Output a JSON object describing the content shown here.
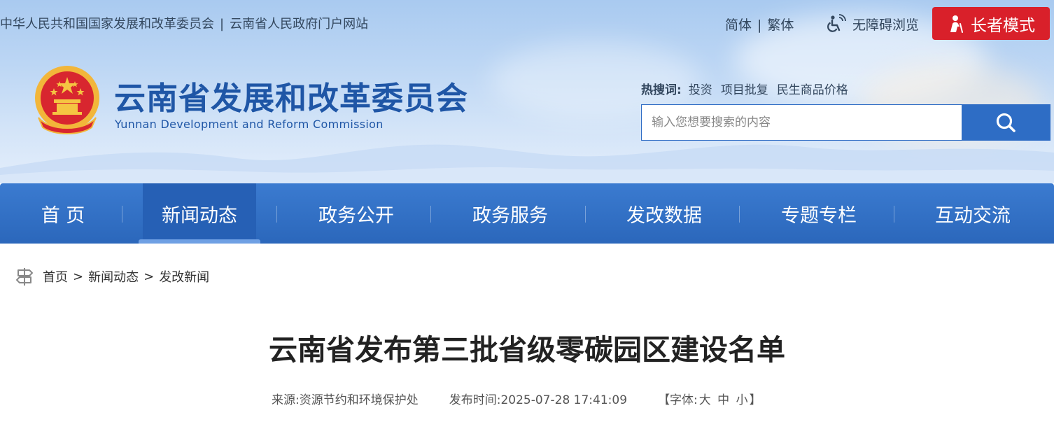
{
  "topbar": {
    "link1": "中华人民共和国国家发展和改革委员会",
    "separator": "|",
    "link2": "云南省人民政府门户网站"
  },
  "lang": {
    "simplified": "简体",
    "separator": "|",
    "traditional": "繁体"
  },
  "accessibility": {
    "label": "无障碍浏览",
    "icon": "wheelchair-signal-icon"
  },
  "elder_mode": {
    "label": "长者模式",
    "icon": "elder-person-icon",
    "color": "#d9202a"
  },
  "site": {
    "title": "云南省发展和改革委员会",
    "title_en": "Yunnan Development and Reform Commission",
    "emblem": "national-emblem"
  },
  "hot_search": {
    "label": "热搜词:",
    "items": [
      "投资",
      "项目批复",
      "民生商品价格"
    ]
  },
  "search": {
    "placeholder": "输入您想要搜索的内容",
    "icon": "search-icon",
    "button_color": "#2e6dc5"
  },
  "nav": {
    "items": [
      {
        "label": "首 页",
        "active": false
      },
      {
        "label": "新闻动态",
        "active": true
      },
      {
        "label": "政务公开",
        "active": false
      },
      {
        "label": "政务服务",
        "active": false
      },
      {
        "label": "发改数据",
        "active": false
      },
      {
        "label": "专题专栏",
        "active": false
      },
      {
        "label": "互动交流",
        "active": false
      }
    ],
    "color": "#2b67bb"
  },
  "breadcrumb": {
    "icon": "signpost-icon",
    "items": [
      "首页",
      "新闻动态",
      "发改新闻"
    ],
    "separator": ">"
  },
  "article": {
    "title": "云南省发布第三批省级零碳园区建设名单",
    "source_label": "来源:",
    "source": "资源节约和环境保护处",
    "time_label": "发布时间:",
    "time": "2025-07-28 17:41:09",
    "font_open": "【字体:",
    "font_large": "大",
    "font_medium": "中",
    "font_small": "小",
    "font_close": "】"
  }
}
